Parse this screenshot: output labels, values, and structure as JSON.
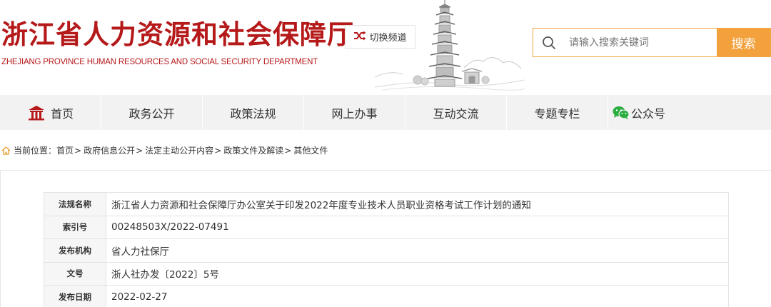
{
  "header": {
    "title": "浙江省人力资源和社会保障厅",
    "subtitle": "ZHEJIANG PROVINCE HUMAN RESOURCES AND SOCIAL SECURITY DEPARTMENT",
    "switch_channel": "切换频道",
    "search_placeholder": "请输入搜索关键词",
    "search_button": "搜索"
  },
  "nav": {
    "items": [
      {
        "label": "首页",
        "icon": "home-icon"
      },
      {
        "label": "政务公开"
      },
      {
        "label": "政策法规"
      },
      {
        "label": "网上办事"
      },
      {
        "label": "互动交流"
      },
      {
        "label": "专题专栏"
      },
      {
        "label": "公众号",
        "icon": "wechat-icon"
      }
    ]
  },
  "breadcrumb": {
    "prefix": "当前位置：",
    "items": [
      "首页",
      "政府信息公开",
      "法定主动公开内容",
      "政策文件及解读",
      "其他文件"
    ],
    "separator": ">"
  },
  "info_table": {
    "rows": [
      {
        "label": "法规名称",
        "value": "浙江省人力资源和社会保障厅办公室关于印发2022年度专业技术人员职业资格考试工作计划的通知"
      },
      {
        "label": "索引号",
        "value": "00248503X/2022-07491"
      },
      {
        "label": "发布机构",
        "value": "省人力社保厅"
      },
      {
        "label": "文号",
        "value": "浙人社办发〔2022〕5号"
      },
      {
        "label": "发布日期",
        "value": "2022-02-27"
      }
    ]
  },
  "colors": {
    "brand_red": "#b5191a",
    "accent_orange": "#f2a13c",
    "nav_bg": "#f2f2f2"
  }
}
